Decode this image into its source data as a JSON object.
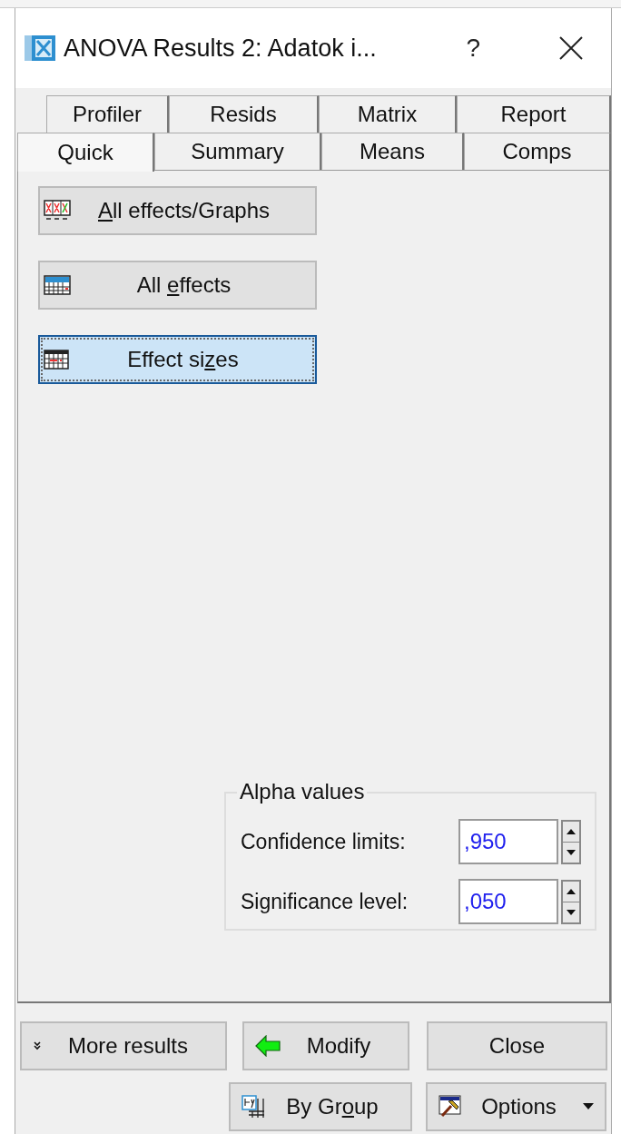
{
  "window": {
    "title": "ANOVA Results 2: Adatok i...",
    "help": "?"
  },
  "tabs": [
    [
      {
        "label": "Profiler",
        "selected": false
      },
      {
        "label": "Resids",
        "selected": false
      },
      {
        "label": "Matrix",
        "selected": false
      },
      {
        "label": "Report",
        "selected": false
      }
    ],
    [
      {
        "label": "Quick",
        "selected": true
      },
      {
        "label": "Summary",
        "selected": false
      },
      {
        "label": "Means",
        "selected": false
      },
      {
        "label": "Comps",
        "selected": false
      }
    ]
  ],
  "actions": [
    {
      "kind": "graphs",
      "access_key": "A",
      "label_after": "ll effects/Graphs",
      "focused": false
    },
    {
      "kind": "table",
      "label_before": "All ",
      "access_key": "e",
      "label_after": "ffects",
      "focused": false
    },
    {
      "kind": "grid",
      "label_before": "Effect si",
      "access_key": "z",
      "label_after": "es",
      "focused": true
    }
  ],
  "alpha_values": {
    "title": "Alpha values",
    "fields": [
      {
        "label": "Confidence limits:",
        "value": ",950"
      },
      {
        "label": "Significance level:",
        "value": ",050"
      }
    ]
  },
  "footer": [
    [
      {
        "kind": "more",
        "label": "More results"
      },
      {
        "kind": "modify",
        "label": "Modify"
      },
      {
        "kind": "plain",
        "label": "Close"
      }
    ],
    [
      {
        "kind": "bygroup",
        "label_before": "By Gr",
        "access_key": "o",
        "label_after": "up"
      },
      {
        "kind": "options",
        "label": "Options"
      }
    ]
  ]
}
